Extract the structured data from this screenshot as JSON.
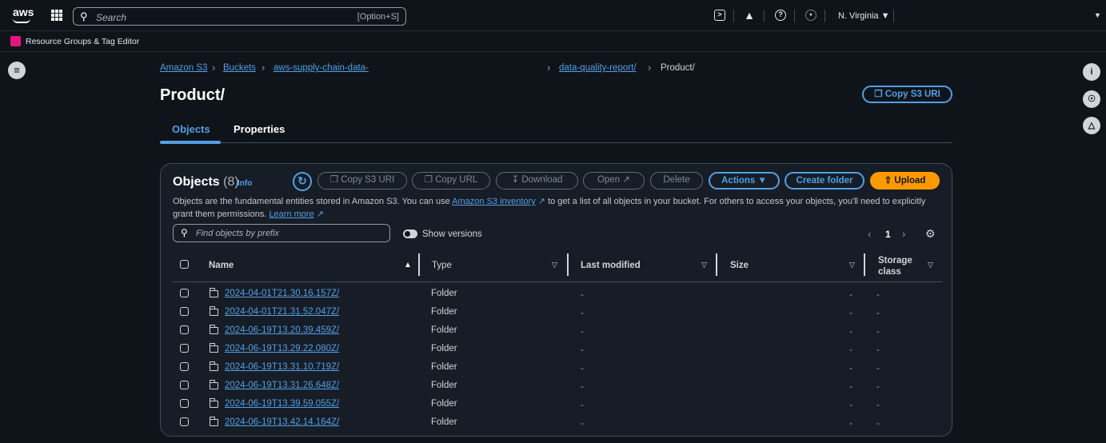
{
  "topbar": {
    "logo": "aws",
    "search_icon": "search-icon",
    "search_placeholder": "Search",
    "search_shortcut": "[Option+S]",
    "region": "N. Virginia ▼",
    "icons": [
      "cloudshell-icon",
      "bell-icon",
      "help-icon",
      "settings-icon"
    ]
  },
  "favorites": {
    "item": "Resource Groups & Tag Editor"
  },
  "breadcrumb": {
    "items": [
      "Amazon S3",
      "Buckets",
      "aws-supply-chain-data-",
      "data-quality-report/",
      "Product/"
    ]
  },
  "page": {
    "title": "Product/",
    "copy_uri": "Copy S3 URI"
  },
  "tabs": [
    "Objects",
    "Properties"
  ],
  "objects_panel": {
    "title": "Objects",
    "count": "(8)",
    "info": "Info",
    "buttons": {
      "copy_uri": "Copy S3 URI",
      "copy_url": "Copy URL",
      "download": "Download",
      "open": "Open",
      "delete": "Delete",
      "actions": "Actions ▼",
      "create_folder": "Create folder",
      "upload": "Upload"
    },
    "desc_pre": "Objects are the fundamental entities stored in Amazon S3. You can use ",
    "desc_link": "Amazon S3 inventory",
    "desc_mid": " to get a list of all objects in your bucket. For others to access your objects, you'll need to explicitly grant them permissions. ",
    "desc_learn": "Learn more",
    "filter_placeholder": "Find objects by prefix",
    "show_versions": "Show versions",
    "page_number": "1",
    "columns": {
      "name": "Name",
      "type": "Type",
      "last_modified": "Last modified",
      "size": "Size",
      "storage_class_1": "Storage",
      "storage_class_2": "class"
    },
    "rows": [
      {
        "name": "2024-04-01T21.30.16.157Z/",
        "type": "Folder",
        "modified": "-",
        "size": "-",
        "storage": "-"
      },
      {
        "name": "2024-04-01T21.31.52.047Z/",
        "type": "Folder",
        "modified": "-",
        "size": "-",
        "storage": "-"
      },
      {
        "name": "2024-06-19T13.20.39.459Z/",
        "type": "Folder",
        "modified": "-",
        "size": "-",
        "storage": "-"
      },
      {
        "name": "2024-06-19T13.29.22.080Z/",
        "type": "Folder",
        "modified": "-",
        "size": "-",
        "storage": "-"
      },
      {
        "name": "2024-06-19T13.31.10.719Z/",
        "type": "Folder",
        "modified": "-",
        "size": "-",
        "storage": "-"
      },
      {
        "name": "2024-06-19T13.31.26.648Z/",
        "type": "Folder",
        "modified": "-",
        "size": "-",
        "storage": "-"
      },
      {
        "name": "2024-06-19T13.39.59.055Z/",
        "type": "Folder",
        "modified": "-",
        "size": "-",
        "storage": "-"
      },
      {
        "name": "2024-06-19T13.42.14.164Z/",
        "type": "Folder",
        "modified": "-",
        "size": "-",
        "storage": "-"
      }
    ]
  },
  "colors": {
    "link": "#539fe5",
    "upload": "#ff9900",
    "background": "#0f141a",
    "panel": "#161d26"
  }
}
